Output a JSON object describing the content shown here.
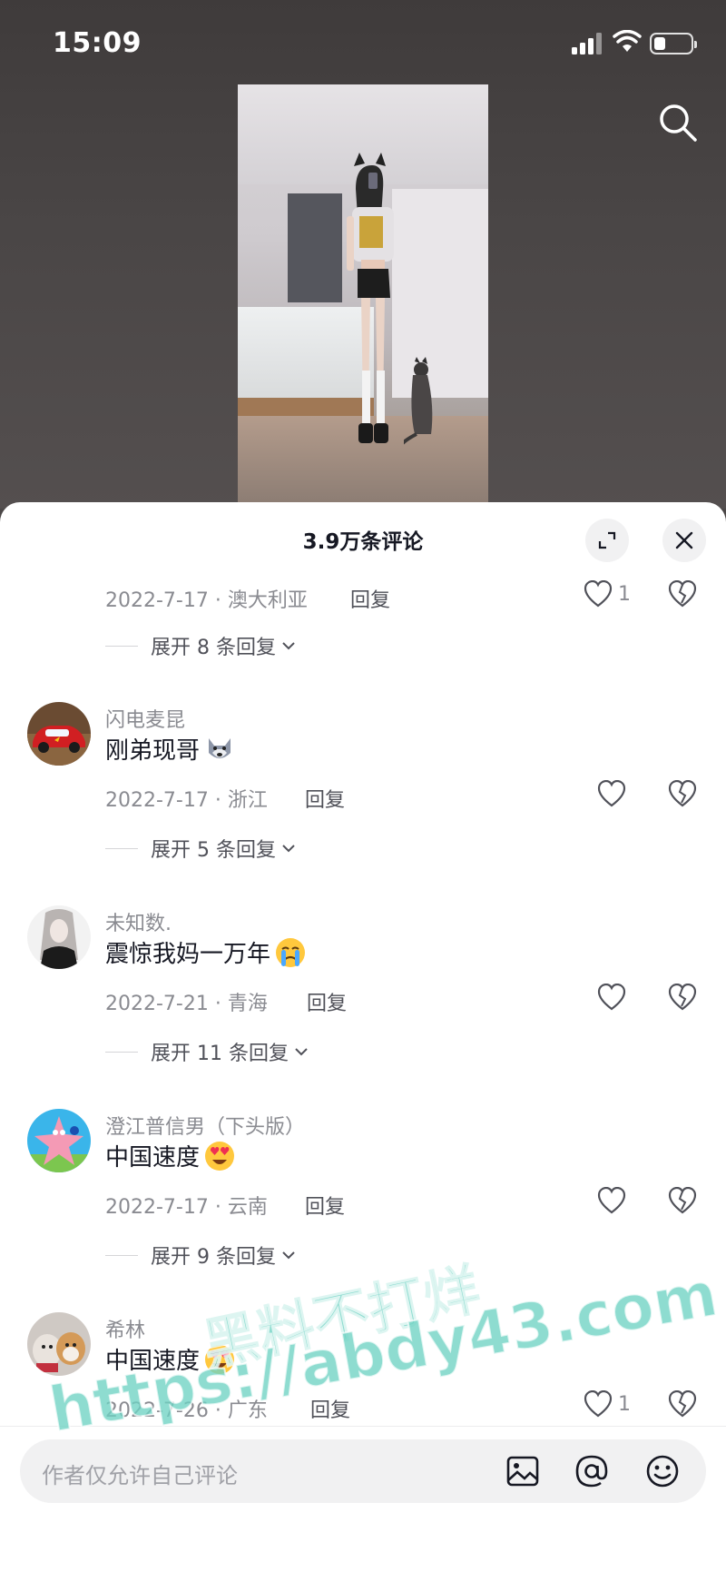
{
  "status_bar": {
    "time": "15:09"
  },
  "panel": {
    "title": "3.9万条评论"
  },
  "first_comment": {
    "meta": "2022-7-17 · 澳大利亚",
    "reply_label": "回复",
    "likes": "1",
    "expand": "展开 8 条回复"
  },
  "comments": [
    {
      "user": "闪电麦昆",
      "text": "刚弟现哥",
      "meta": "2022-7-17 · 浙江",
      "reply_label": "回复",
      "likes": "",
      "expand": "展开 5 条回复",
      "avatar": "car-avatar",
      "emoji": "wolf-emoji"
    },
    {
      "user": "未知数.",
      "text": "震惊我妈一万年",
      "meta": "2022-7-21 · 青海",
      "reply_label": "回复",
      "likes": "",
      "expand": "展开 11 条回复",
      "avatar": "girl-avatar",
      "emoji": "crying-emoji"
    },
    {
      "user": "澄江普信男（下头版）",
      "text": "中国速度",
      "meta": "2022-7-17 · 云南",
      "reply_label": "回复",
      "likes": "",
      "expand": "展开 9 条回复",
      "avatar": "starfish-avatar",
      "emoji": "heart-eyes-emoji"
    },
    {
      "user": "希林",
      "text": "中国速度",
      "meta": "2022-7-26 · 广东",
      "reply_label": "回复",
      "likes": "1",
      "expand": "",
      "avatar": "dog-avatar",
      "emoji": "heart-eyes-emoji"
    }
  ],
  "input": {
    "placeholder": "作者仅允许自己评论"
  },
  "watermark": {
    "line1": "黑料不打烊",
    "line2": "https://abdy43.com"
  },
  "colors": {
    "panel_bg": "#ffffff",
    "text_primary": "#161823",
    "text_secondary": "#8a8b91",
    "watermark": "#6ed2c3"
  }
}
